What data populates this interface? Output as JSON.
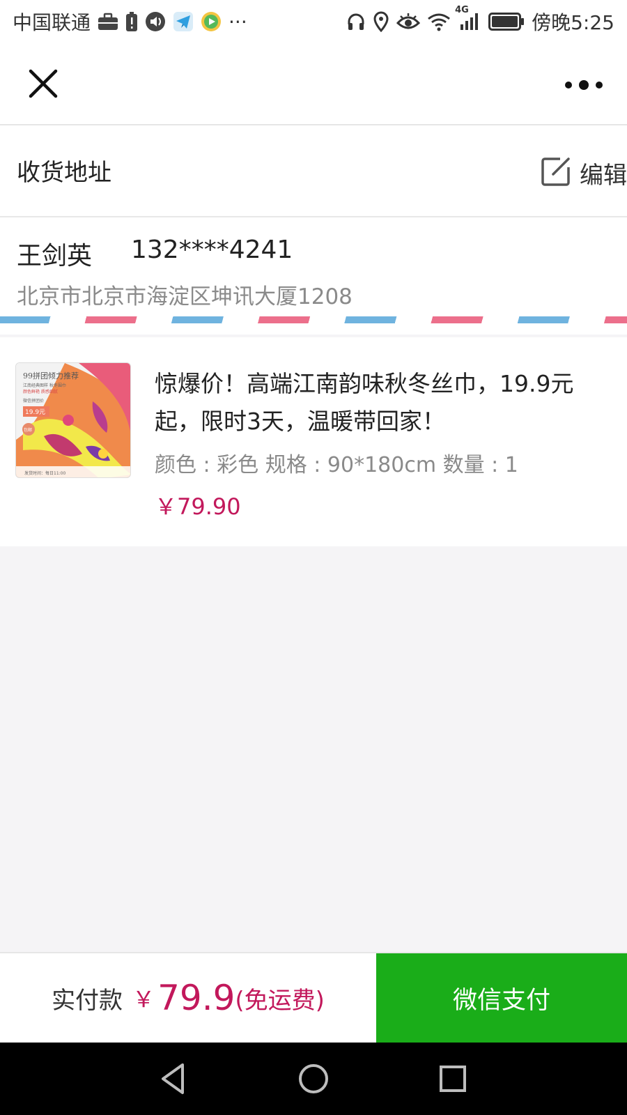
{
  "status_bar": {
    "carrier": "中国联通",
    "more_indicator": "···",
    "network": "4G",
    "time": "傍晚5:25",
    "left_icons": [
      "briefcase-icon",
      "battery-alert-icon",
      "sound-icon",
      "telegram-icon",
      "video-app-icon"
    ],
    "right_icons": [
      "headphones-icon",
      "location-icon",
      "eye-icon",
      "wifi-icon",
      "signal-icon",
      "battery-icon"
    ]
  },
  "nav": {
    "close_icon": "close-icon",
    "more_icon": "more-dots-icon"
  },
  "address": {
    "section_title": "收货地址",
    "edit_label": "编辑",
    "recipient_name": "王剑英",
    "phone": "132****4241",
    "full_address": "北京市北京市海淀区坤讯大厦1208"
  },
  "product": {
    "thumbnail_alt": "丝巾商品图",
    "thumbnail_text": {
      "headline": "99拼团倾力推荐",
      "sub1": "江南经典图样 秋冬围巾",
      "sub2": "颜色鲜艳 质感细腻",
      "price_caption": "微信拼团价",
      "price_tag": "19.9元",
      "badge": "包邮",
      "footer": "发货时间：每日11:00"
    },
    "title": "惊爆价！高端江南韵味秋冬丝巾，19.9元起，限时3天，温暖带回家！",
    "specs": "颜色 : 彩色  规格 : 90*180cm  数量 : 1",
    "price": "￥79.90"
  },
  "footer": {
    "total_label": "实付款",
    "currency": "￥",
    "total_amount": "79.9",
    "shipping_note": "(免运费)",
    "pay_button": "微信支付"
  },
  "system_nav": {
    "back_icon": "back-triangle-icon",
    "home_icon": "home-circle-icon",
    "recents_icon": "recents-square-icon"
  },
  "colors": {
    "accent_price": "#c2185b",
    "pay_green": "#1aad19",
    "airmail_blue": "#6fb3df",
    "airmail_red": "#ec6f8b"
  }
}
